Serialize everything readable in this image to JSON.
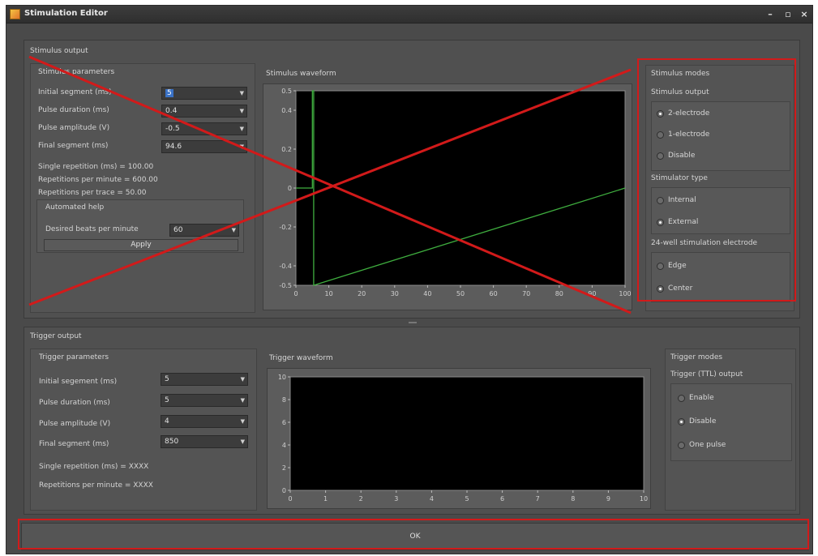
{
  "window": {
    "title": "Stimulation Editor",
    "controls": {
      "minimize": "–",
      "maximize": "▫",
      "close": "×"
    }
  },
  "stimulus": {
    "section_title": "Stimulus output",
    "params_title": "Stimulus parameters",
    "params": [
      {
        "label": "Initial segment (ms)",
        "value": "5",
        "selected": true
      },
      {
        "label": "Pulse duration (ms)",
        "value": "0.4"
      },
      {
        "label": "Pulse amplitude (V)",
        "value": "-0.5"
      },
      {
        "label": "Final segment (ms)",
        "value": "94.6"
      }
    ],
    "info": [
      "Single repetition (ms) = 100.00",
      "Repetitions per minute = 600.00",
      "Repetitions per trace = 50.00"
    ],
    "automated_help": {
      "title": "Automated help",
      "beats_label": "Desired beats per minute",
      "beats_value": "60",
      "apply_label": "Apply"
    },
    "waveform_title": "Stimulus waveform",
    "modes": {
      "title": "Stimulus modes",
      "output_title": "Stimulus output",
      "output_options": [
        {
          "label": "2-electrode",
          "checked": true
        },
        {
          "label": "1-electrode",
          "checked": false
        },
        {
          "label": "Disable",
          "checked": false
        }
      ],
      "type_title": "Stimulator type",
      "type_options": [
        {
          "label": "Internal",
          "checked": false
        },
        {
          "label": "External",
          "checked": true
        }
      ],
      "electrode_title": "24-well stimulation electrode",
      "electrode_options": [
        {
          "label": "Edge",
          "checked": false
        },
        {
          "label": "Center",
          "checked": true
        }
      ]
    }
  },
  "trigger": {
    "section_title": "Trigger output",
    "params_title": "Trigger parameters",
    "params": [
      {
        "label": "Initial segement (ms)",
        "value": "5"
      },
      {
        "label": "Pulse duration (ms)",
        "value": "5"
      },
      {
        "label": "Pulse amplitude (V)",
        "value": "4"
      },
      {
        "label": "Final segment (ms)",
        "value": "850"
      }
    ],
    "info": [
      "Single repetition (ms) = XXXX",
      "Repetitions per minute = XXXX"
    ],
    "waveform_title": "Trigger waveform",
    "modes": {
      "title": "Trigger modes",
      "output_title": "Trigger (TTL) output",
      "options": [
        {
          "label": "Enable",
          "checked": false
        },
        {
          "label": "Disable",
          "checked": true
        },
        {
          "label": "One pulse",
          "checked": false
        }
      ]
    }
  },
  "ok_label": "OK",
  "chart_data": [
    {
      "type": "line",
      "title": "Stimulus waveform",
      "xlim": [
        0,
        100
      ],
      "ylim": [
        -0.5,
        0.5
      ],
      "x_ticks": [
        "0",
        "10",
        "20",
        "30",
        "40",
        "50",
        "60",
        "70",
        "80",
        "90",
        "100"
      ],
      "y_ticks": [
        "0.5",
        "0.4",
        "0.2",
        "0",
        "-0.2",
        "-0.4",
        "-0.5"
      ],
      "series": [
        {
          "color": "#3fae3f",
          "x": [
            0,
            5,
            5,
            5.4,
            5.4,
            100
          ],
          "y": [
            0,
            0,
            0.5,
            0.5,
            -0.5,
            0
          ]
        }
      ]
    },
    {
      "type": "line",
      "title": "Trigger waveform",
      "xlim": [
        0,
        10
      ],
      "ylim": [
        0,
        10
      ],
      "x_ticks": [
        "0",
        "1",
        "2",
        "3",
        "4",
        "5",
        "6",
        "7",
        "8",
        "9",
        "10"
      ],
      "y_ticks": [
        "10",
        "8",
        "6",
        "4",
        "2",
        "0"
      ],
      "series": []
    }
  ],
  "colors": {
    "annotation_red": "#d21a1a",
    "waveform_green": "#3fae3f",
    "selection_blue": "#3a72c6"
  }
}
